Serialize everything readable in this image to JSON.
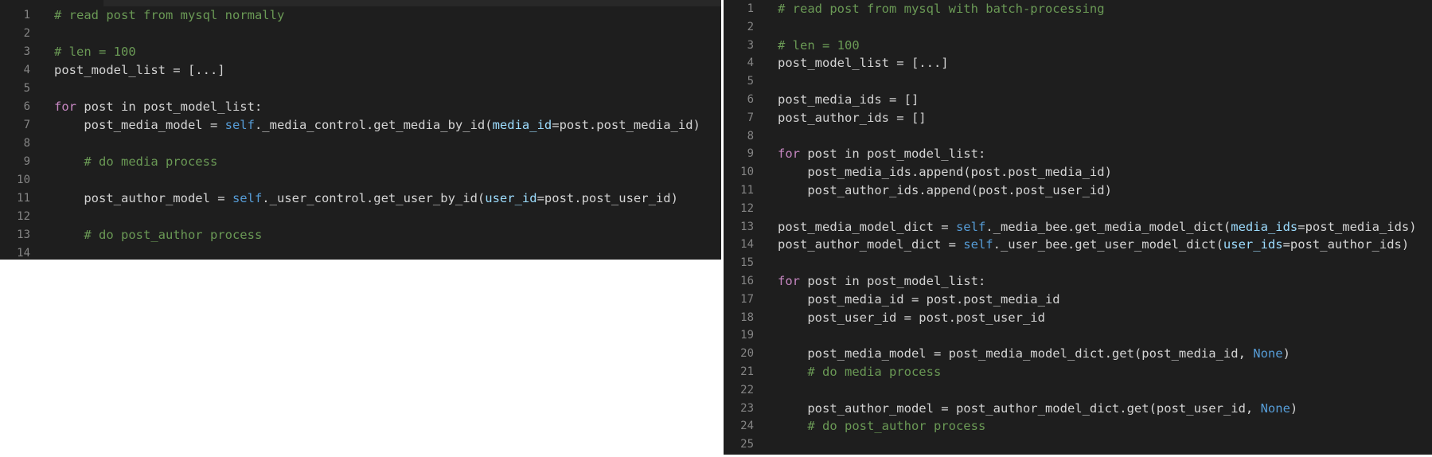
{
  "left_editor": {
    "lines": [
      {
        "n": "1",
        "segs": [
          {
            "t": "# read post from mysql normally",
            "c": "cm"
          }
        ]
      },
      {
        "n": "2",
        "segs": []
      },
      {
        "n": "3",
        "segs": [
          {
            "t": "# len = 100",
            "c": "cm"
          }
        ]
      },
      {
        "n": "4",
        "segs": [
          {
            "t": "post_model_list = [...]",
            "c": ""
          }
        ]
      },
      {
        "n": "5",
        "segs": []
      },
      {
        "n": "6",
        "segs": [
          {
            "t": "for",
            "c": "kw"
          },
          {
            "t": " post in post_model_list:",
            "c": ""
          }
        ]
      },
      {
        "n": "7",
        "segs": [
          {
            "t": "    post_media_model = ",
            "c": ""
          },
          {
            "t": "self",
            "c": "sf"
          },
          {
            "t": "._media_control.get_media_by_id(",
            "c": ""
          },
          {
            "t": "media_id",
            "c": "pr"
          },
          {
            "t": "=post.post_media_id)",
            "c": ""
          }
        ]
      },
      {
        "n": "8",
        "segs": []
      },
      {
        "n": "9",
        "segs": [
          {
            "t": "    # do media process",
            "c": "cm"
          }
        ]
      },
      {
        "n": "10",
        "segs": []
      },
      {
        "n": "11",
        "segs": [
          {
            "t": "    post_author_model = ",
            "c": ""
          },
          {
            "t": "self",
            "c": "sf"
          },
          {
            "t": "._user_control.get_user_by_id(",
            "c": ""
          },
          {
            "t": "user_id",
            "c": "pr"
          },
          {
            "t": "=post.post_user_id)",
            "c": ""
          }
        ]
      },
      {
        "n": "12",
        "segs": []
      },
      {
        "n": "13",
        "segs": [
          {
            "t": "    # do post_author process",
            "c": "cm"
          }
        ]
      },
      {
        "n": "14",
        "segs": []
      }
    ]
  },
  "right_editor": {
    "lines": [
      {
        "n": "1",
        "segs": [
          {
            "t": "# read post from mysql with batch-processing",
            "c": "cm"
          }
        ]
      },
      {
        "n": "2",
        "segs": []
      },
      {
        "n": "3",
        "segs": [
          {
            "t": "# len = 100",
            "c": "cm"
          }
        ]
      },
      {
        "n": "4",
        "segs": [
          {
            "t": "post_model_list = [...]",
            "c": ""
          }
        ]
      },
      {
        "n": "5",
        "segs": []
      },
      {
        "n": "6",
        "segs": [
          {
            "t": "post_media_ids = []",
            "c": ""
          }
        ]
      },
      {
        "n": "7",
        "segs": [
          {
            "t": "post_author_ids = []",
            "c": ""
          }
        ]
      },
      {
        "n": "8",
        "segs": []
      },
      {
        "n": "9",
        "segs": [
          {
            "t": "for",
            "c": "kw"
          },
          {
            "t": " post in post_model_list:",
            "c": ""
          }
        ]
      },
      {
        "n": "10",
        "segs": [
          {
            "t": "    post_media_ids.append(post.post_media_id)",
            "c": ""
          }
        ]
      },
      {
        "n": "11",
        "segs": [
          {
            "t": "    post_author_ids.append(post.post_user_id)",
            "c": ""
          }
        ]
      },
      {
        "n": "12",
        "segs": []
      },
      {
        "n": "13",
        "segs": [
          {
            "t": "post_media_model_dict = ",
            "c": ""
          },
          {
            "t": "self",
            "c": "sf"
          },
          {
            "t": "._media_bee.get_media_model_dict(",
            "c": ""
          },
          {
            "t": "media_ids",
            "c": "pr"
          },
          {
            "t": "=post_media_ids)",
            "c": ""
          }
        ]
      },
      {
        "n": "14",
        "segs": [
          {
            "t": "post_author_model_dict = ",
            "c": ""
          },
          {
            "t": "self",
            "c": "sf"
          },
          {
            "t": "._user_bee.get_user_model_dict(",
            "c": ""
          },
          {
            "t": "user_ids",
            "c": "pr"
          },
          {
            "t": "=post_author_ids)",
            "c": ""
          }
        ]
      },
      {
        "n": "15",
        "segs": []
      },
      {
        "n": "16",
        "segs": [
          {
            "t": "for",
            "c": "kw"
          },
          {
            "t": " post in post_model_list:",
            "c": ""
          }
        ]
      },
      {
        "n": "17",
        "segs": [
          {
            "t": "    post_media_id = post.post_media_id",
            "c": ""
          }
        ]
      },
      {
        "n": "18",
        "segs": [
          {
            "t": "    post_user_id = post.post_user_id",
            "c": ""
          }
        ]
      },
      {
        "n": "19",
        "segs": []
      },
      {
        "n": "20",
        "segs": [
          {
            "t": "    post_media_model = post_media_model_dict.get(post_media_id, ",
            "c": ""
          },
          {
            "t": "None",
            "c": "nn"
          },
          {
            "t": ")",
            "c": ""
          }
        ]
      },
      {
        "n": "21",
        "segs": [
          {
            "t": "    # do media process",
            "c": "cm"
          }
        ]
      },
      {
        "n": "22",
        "segs": []
      },
      {
        "n": "23",
        "segs": [
          {
            "t": "    post_author_model = post_author_model_dict.get(post_user_id, ",
            "c": ""
          },
          {
            "t": "None",
            "c": "nn"
          },
          {
            "t": ")",
            "c": ""
          }
        ]
      },
      {
        "n": "24",
        "segs": [
          {
            "t": "    # do post_author process",
            "c": "cm"
          }
        ]
      },
      {
        "n": "25",
        "segs": []
      }
    ]
  }
}
